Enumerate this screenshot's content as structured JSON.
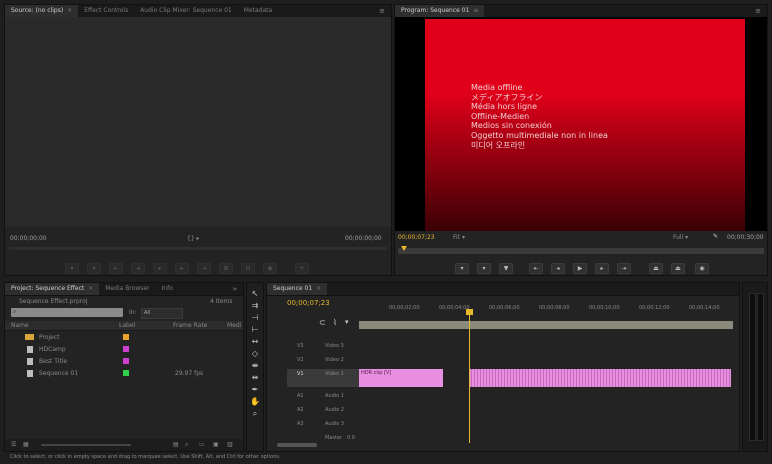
{
  "source_monitor": {
    "tabs": [
      "Source: (no clips)",
      "Effect Controls",
      "Audio Clip Mixer: Sequence 01",
      "Metadata"
    ],
    "timecode_left": "00;00;00;00",
    "timecode_right": "00;00;00;00",
    "zoom": "{} ▸"
  },
  "program_monitor": {
    "tab": "Program: Sequence 01",
    "offline_lines": [
      "Media offline",
      "メディアオフライン",
      "Média hors ligne",
      "Offline-Medien",
      "Medios sin conexión",
      "Oggetto multimediale non in linea",
      "미디어 오프라인"
    ],
    "timecode": "00;00;07;23",
    "fit": "Fit",
    "zoom": "Full",
    "duration": "00;00;30;00"
  },
  "project_panel": {
    "tabs": [
      "Project: Sequence Effect",
      "Media Browser",
      "Info"
    ],
    "project_file": "Sequence Effect.prproj",
    "item_count": "4 Items",
    "search_placeholder": "",
    "in_label": "In:",
    "in_value": "All",
    "columns": [
      "Name",
      "Label",
      "Frame Rate",
      "Medi"
    ],
    "items": [
      {
        "name": "Project",
        "label_color": "#e8a42a",
        "frame_rate": ""
      },
      {
        "name": "HDCamp",
        "label_color": "#d040d0",
        "frame_rate": ""
      },
      {
        "name": "Best Title",
        "label_color": "#d040d0",
        "frame_rate": ""
      },
      {
        "name": "Sequence 01",
        "label_color": "#2fd04a",
        "frame_rate": "29.97 fps"
      }
    ]
  },
  "timeline": {
    "tab": "Sequence 01",
    "timecode": "00;00;07;23",
    "ruler_ticks": [
      "00;00;02;00",
      "00;00;04;00",
      "00;00;06;00",
      "00;00;08;00",
      "00;00;10;00",
      "00;00;12;00",
      "00;00;14;00"
    ],
    "video_tracks": [
      "V3",
      "V2",
      "V1"
    ],
    "audio_tracks": [
      "A1",
      "A2",
      "A3"
    ],
    "video_track_names": [
      "Video 3",
      "Video 2",
      "Video 1"
    ],
    "audio_track_names": [
      "Audio 1",
      "Audio 2",
      "Audio 3"
    ],
    "master_label": "Master",
    "master_value": "0.0",
    "clip_label": "HDR clip [V]"
  },
  "status_bar": {
    "text": "Click to select, or click in empty space and drag to marquee select. Use Shift, Alt, and Ctrl for other options."
  },
  "colors": {
    "offline_red": "#e0001a",
    "clip_pink": "#e98fe1",
    "playhead": "#e8b72b",
    "panel_bg": "#232323"
  }
}
